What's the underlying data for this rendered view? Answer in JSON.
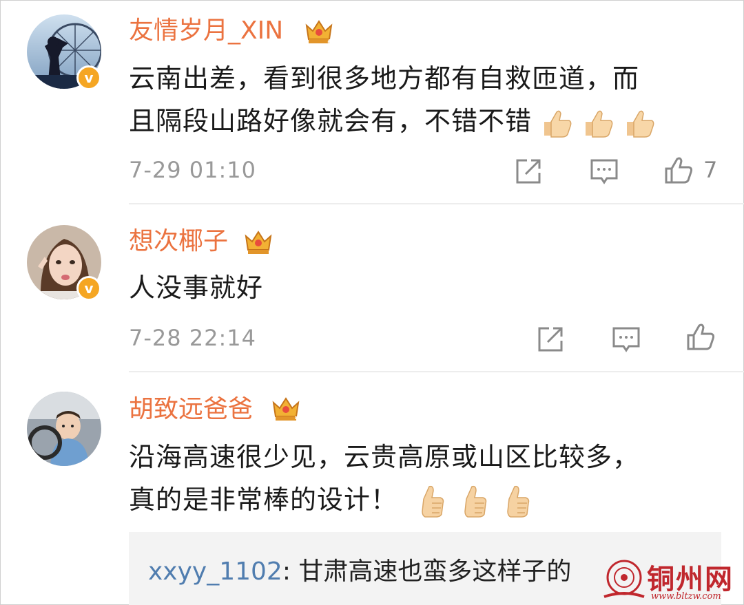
{
  "colors": {
    "username": "#eb7340",
    "reply_user": "#507daf",
    "badge": "#f5a623",
    "meta": "#999999"
  },
  "comments": [
    {
      "username": "友情岁月_XIN",
      "badge_level": "6",
      "lines": [
        "云南出差，看到很多地方都有自救匝道，而",
        "且隔段山路好像就会有，不错不错"
      ],
      "emoji_count": 3,
      "time": "7-29 01:10",
      "likes": "7",
      "icons": [
        "share-icon",
        "comment-icon",
        "like-icon"
      ]
    },
    {
      "username": "想次椰子",
      "badge_level": "",
      "lines": [
        "人没事就好"
      ],
      "time": "7-28 22:14",
      "likes": "",
      "icons": [
        "share-icon",
        "comment-icon",
        "like-icon"
      ]
    },
    {
      "username": "胡致远爸爸",
      "badge_level": "5",
      "lines": [
        "沿海高速很少见，云贵高原或山区比较多，",
        "真的是非常棒的设计！"
      ],
      "emoji_count": 3,
      "reply": {
        "user": "xxyy_1102",
        "text": "甘肃高速也蛮多这样子的"
      }
    }
  ],
  "watermark": {
    "name": "铜州网",
    "url": "www.bltzw.com"
  }
}
